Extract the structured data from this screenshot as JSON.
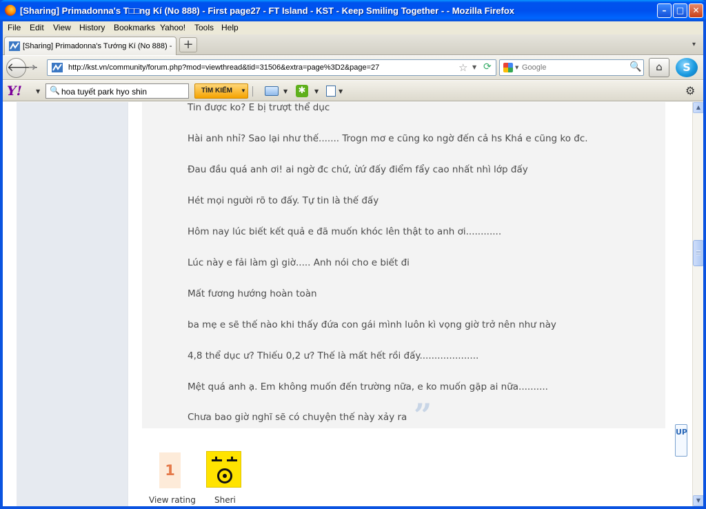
{
  "window": {
    "title": "[Sharing] Primadonna's T□□ng Kí (No 888) - First page27 - FT Island - KST - Keep Smiling Together - - Mozilla Firefox",
    "minimize": "–",
    "maximize": "□",
    "close": "✕"
  },
  "menu": [
    "File",
    "Edit",
    "View",
    "History",
    "Bookmarks",
    "Yahoo!",
    "Tools",
    "Help"
  ],
  "tabs": [
    {
      "label": "[Sharing] Primadonna's Tướng Kí (No 888) - ..."
    }
  ],
  "new_tab_label": "+",
  "navigation": {
    "url": "http://kst.vn/community/forum.php?mod=viewthread&tid=31506&extra=page%3D2&page=27",
    "search_placeholder": "Google"
  },
  "yahoo_toolbar": {
    "logo": "Y!",
    "search_value": "hoa tuyết park hyo shin",
    "search_button": "TÌM KIẾM"
  },
  "post": {
    "lines": [
      "Tin được ko? E bị trượt thể dục",
      "Hài anh nhỉ? Sao lại như thế....... Trogn mơ e cũng ko ngờ đến cả hs Khá e cũng ko đc.",
      "Đau đầu quá anh ơi! ai ngờ đc chứ, ừứ đấy điểm fẩy cao nhất nhì lớp đấy",
      "Hét mọi người rõ to đấy. Tự tin là thế đấy",
      "Hôm nay lúc biết kết quả e đã muốn khóc lên thật to anh ơi............",
      "Lúc này e fải làm gì giờ..... Anh nói cho e biết đi",
      "Mất fương hướng hoàn toàn",
      "ba mẹ e sẽ thế nào khi thấy đứa con gái mình luôn kì vọng giờ trở nên như này",
      "4,8 thể dục ư? Thiếu 0,2 ư? Thế là mất hết rồi đấy....................",
      "Mệt quá anh ạ. Em không muốn đến trường nữa, e ko muốn gặp ai nữa..........",
      "Chưa bao giờ nghĩ sẽ có chuyện thế này xảy ra"
    ],
    "close_quote": "”"
  },
  "rating": {
    "count": "1",
    "label": "View rating"
  },
  "rater": {
    "name": "Sheri"
  },
  "back_to_top": "UP"
}
